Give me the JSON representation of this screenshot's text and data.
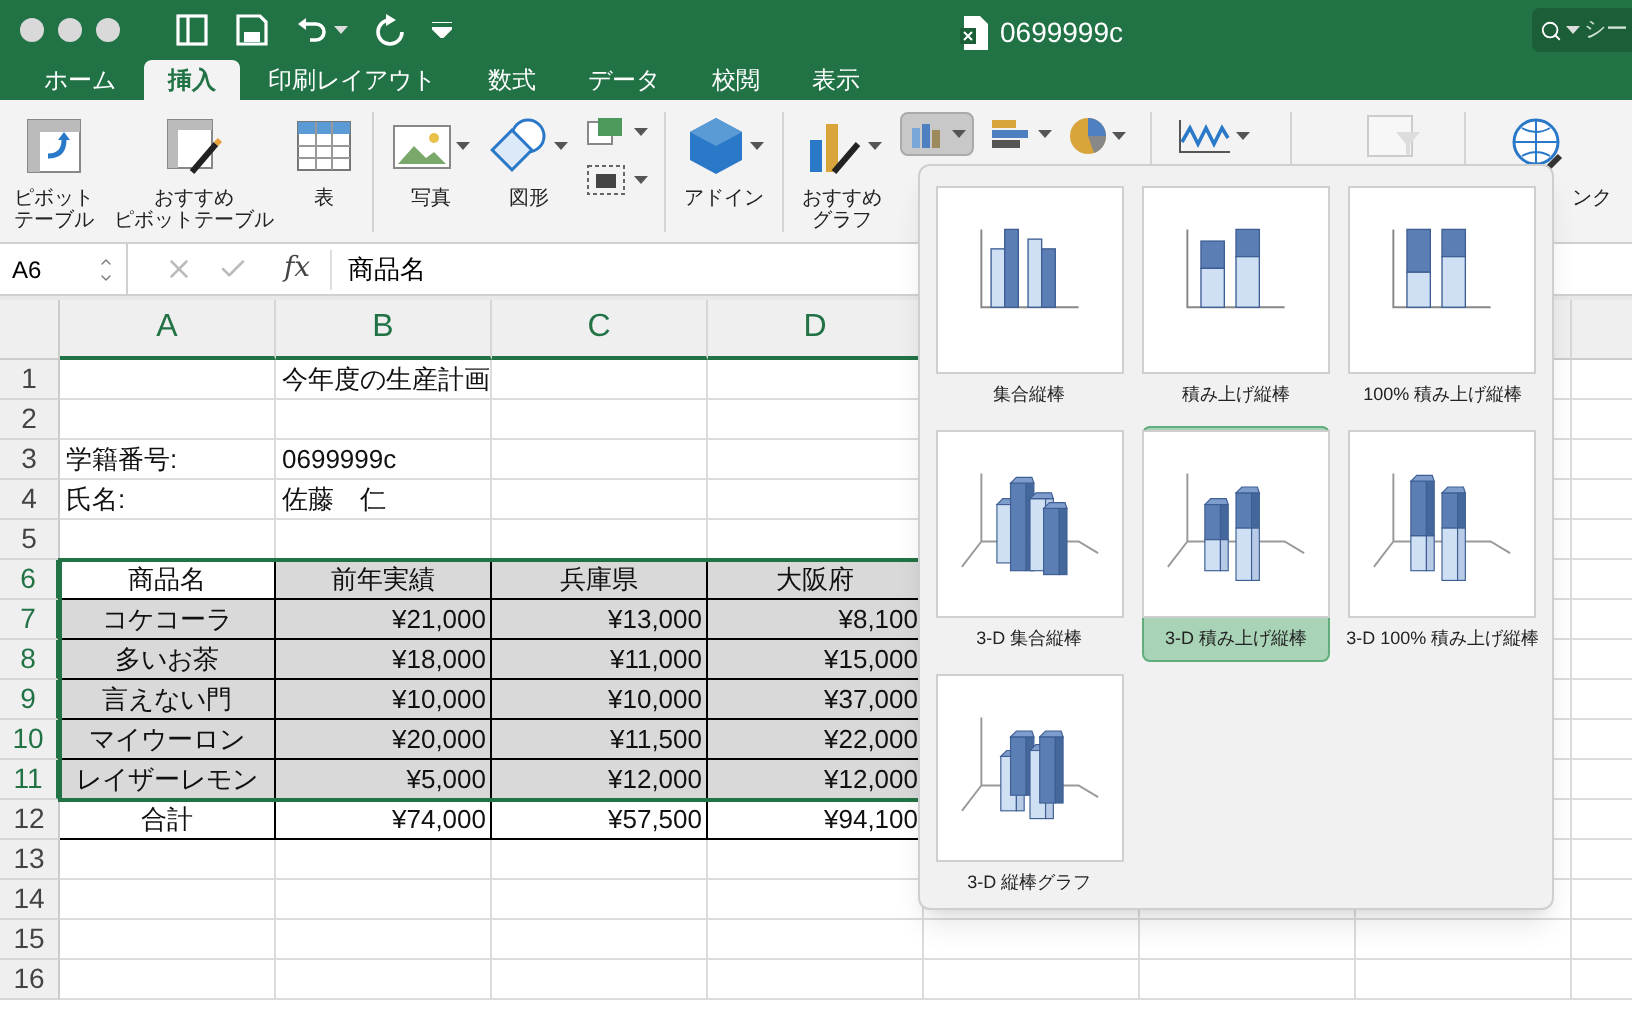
{
  "window": {
    "title": "0699999c",
    "search": {
      "value": "シー"
    }
  },
  "tabs": [
    {
      "label": "ホーム",
      "selected": false
    },
    {
      "label": "挿入",
      "selected": true
    },
    {
      "label": "印刷レイアウト",
      "selected": false
    },
    {
      "label": "数式",
      "selected": false
    },
    {
      "label": "データ",
      "selected": false
    },
    {
      "label": "校閲",
      "selected": false
    },
    {
      "label": "表示",
      "selected": false
    }
  ],
  "ribbon": [
    {
      "kind": "pivot",
      "lines": [
        "ピボット",
        "テーブル"
      ]
    },
    {
      "kind": "recpivot",
      "lines": [
        "おすすめ",
        "ピボットテーブル"
      ]
    },
    {
      "kind": "table",
      "lines": [
        "表"
      ]
    },
    {
      "kind": "divider"
    },
    {
      "kind": "photo",
      "lines": [
        "写真"
      ]
    },
    {
      "kind": "shapes",
      "lines": [
        "図形"
      ]
    },
    {
      "kind": "smallpair"
    },
    {
      "kind": "divider"
    },
    {
      "kind": "addin",
      "lines": [
        "アドイン"
      ]
    },
    {
      "kind": "divider"
    },
    {
      "kind": "recchart",
      "lines": [
        "おすすめ",
        "グラフ"
      ]
    },
    {
      "kind": "charts"
    },
    {
      "kind": "link",
      "lines": [
        "ンク"
      ]
    }
  ],
  "formula_bar": {
    "name_box": "A6",
    "fx": "fx",
    "value": "商品名"
  },
  "sheet": {
    "columns": [
      {
        "label": "A",
        "selected": true
      },
      {
        "label": "B",
        "selected": true
      },
      {
        "label": "C",
        "selected": true
      },
      {
        "label": "D",
        "selected": true
      }
    ],
    "rows": [
      {
        "number": "1",
        "selected": false,
        "cells": [
          {},
          {
            "text": "今年度の生産計画",
            "kind": "plain"
          }
        ]
      },
      {
        "number": "2",
        "selected": false,
        "cells": []
      },
      {
        "number": "3",
        "selected": false,
        "cells": [
          {
            "text": "学籍番号:",
            "kind": "plain"
          },
          {
            "text": "0699999c",
            "kind": "plain"
          }
        ]
      },
      {
        "number": "4",
        "selected": false,
        "cells": [
          {
            "text": "氏名:",
            "kind": "plain"
          },
          {
            "text": "佐藤　仁",
            "kind": "plain"
          }
        ]
      },
      {
        "number": "5",
        "selected": false,
        "cells": []
      },
      {
        "number": "6",
        "selected": true,
        "cells": [
          {
            "text": "商品名",
            "kind": "head",
            "shaded": false
          },
          {
            "text": "前年実績",
            "kind": "head",
            "shaded": true
          },
          {
            "text": "兵庫県",
            "kind": "head",
            "shaded": true
          },
          {
            "text": "大阪府",
            "kind": "head",
            "shaded": true
          }
        ]
      },
      {
        "number": "7",
        "selected": true,
        "cells": [
          {
            "text": "コケコーラ",
            "kind": "head",
            "shaded": true
          },
          {
            "text": "¥21,000",
            "kind": "amount",
            "shaded": true
          },
          {
            "text": "¥13,000",
            "kind": "amount",
            "shaded": true
          },
          {
            "text": "¥8,100",
            "kind": "amount",
            "shaded": true
          }
        ]
      },
      {
        "number": "8",
        "selected": true,
        "cells": [
          {
            "text": "多いお茶",
            "kind": "head",
            "shaded": true
          },
          {
            "text": "¥18,000",
            "kind": "amount",
            "shaded": true
          },
          {
            "text": "¥11,000",
            "kind": "amount",
            "shaded": true
          },
          {
            "text": "¥15,000",
            "kind": "amount",
            "shaded": true
          }
        ]
      },
      {
        "number": "9",
        "selected": true,
        "cells": [
          {
            "text": "言えない門",
            "kind": "head",
            "shaded": true
          },
          {
            "text": "¥10,000",
            "kind": "amount",
            "shaded": true
          },
          {
            "text": "¥10,000",
            "kind": "amount",
            "shaded": true
          },
          {
            "text": "¥37,000",
            "kind": "amount",
            "shaded": true
          }
        ]
      },
      {
        "number": "10",
        "selected": true,
        "cells": [
          {
            "text": "マイウーロン",
            "kind": "head",
            "shaded": true
          },
          {
            "text": "¥20,000",
            "kind": "amount",
            "shaded": true
          },
          {
            "text": "¥11,500",
            "kind": "amount",
            "shaded": true
          },
          {
            "text": "¥22,000",
            "kind": "amount",
            "shaded": true
          }
        ]
      },
      {
        "number": "11",
        "selected": true,
        "cells": [
          {
            "text": "レイザーレモン",
            "kind": "head",
            "shaded": true
          },
          {
            "text": "¥5,000",
            "kind": "amount",
            "shaded": true
          },
          {
            "text": "¥12,000",
            "kind": "amount",
            "shaded": true
          },
          {
            "text": "¥12,000",
            "kind": "amount",
            "shaded": true
          }
        ]
      },
      {
        "number": "12",
        "selected": false,
        "cells": [
          {
            "text": "合計",
            "kind": "head",
            "shaded": false
          },
          {
            "text": "¥74,000",
            "kind": "amount",
            "shaded": false
          },
          {
            "text": "¥57,500",
            "kind": "amount",
            "shaded": false
          },
          {
            "text": "¥94,100",
            "kind": "amount",
            "shaded": false
          }
        ]
      },
      {
        "number": "13",
        "selected": false,
        "cells": []
      },
      {
        "number": "14",
        "selected": false,
        "cells": []
      },
      {
        "number": "15",
        "selected": false,
        "cells": []
      },
      {
        "number": "16",
        "selected": false,
        "cells": []
      }
    ]
  },
  "chart_menu": [
    {
      "kind": "clustered",
      "label": "集合縦棒",
      "selected": false
    },
    {
      "kind": "stacked",
      "label": "積み上げ縦棒",
      "selected": false
    },
    {
      "kind": "percent",
      "label": "100% 積み上げ縦棒",
      "selected": false
    },
    {
      "kind": "clustered3d",
      "label": "3-D 集合縦棒",
      "selected": false
    },
    {
      "kind": "stacked3d",
      "label": "3-D 積み上げ縦棒",
      "selected": true
    },
    {
      "kind": "percent3d",
      "label": "3-D 100% 積み上げ縦棒",
      "selected": false
    },
    {
      "kind": "column3d",
      "label": "3-D 縦棒グラフ",
      "selected": false
    }
  ]
}
